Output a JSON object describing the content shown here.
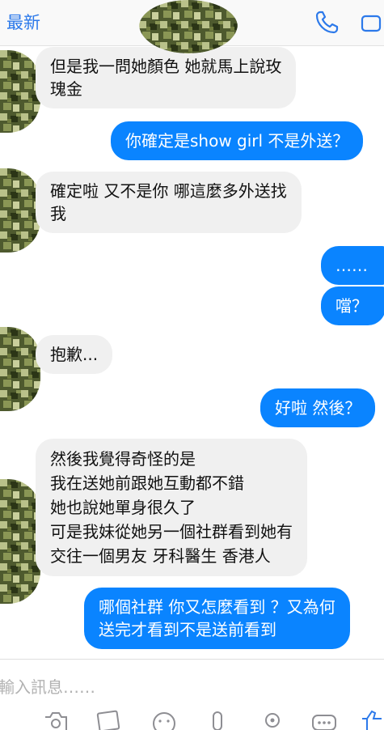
{
  "header": {
    "back_label": "最新",
    "call_icon": "phone-icon",
    "video_icon": "video-camera-icon",
    "accent_color": "#2c79ea"
  },
  "messages": [
    {
      "from": "them",
      "lines": [
        "但是我一問她顏色 她就馬上說玫",
        "瑰金"
      ]
    },
    {
      "from": "me",
      "lines": [
        "你確定是show girl 不是外送？"
      ]
    },
    {
      "from": "them",
      "lines": [
        "確定啦 又不是你 哪這麼多外送找",
        "我"
      ]
    },
    {
      "from": "me",
      "lines": [
        "……"
      ]
    },
    {
      "from": "me",
      "lines": [
        "噹？"
      ]
    },
    {
      "from": "them",
      "lines": [
        "抱歉..."
      ]
    },
    {
      "from": "me",
      "lines": [
        "好啦 然後？"
      ]
    },
    {
      "from": "them",
      "lines": [
        "然後我覺得奇怪的是",
        "我在送她前跟她互動都不錯",
        "她也說她單身很久了",
        "可是我妹從她另一個社群看到她有",
        "交往一個男友 牙科醫生 香港人"
      ]
    },
    {
      "from": "me",
      "lines": [
        "哪個社群  你又怎麼看到 ？又為何",
        "送完才看到不是送前看到"
      ]
    }
  ],
  "colors": {
    "outgoing_bubble": "#0a84ff",
    "incoming_bubble": "#f0f0f0"
  },
  "compose": {
    "placeholder": "輸入訊息……",
    "icons": [
      "camera-icon",
      "photo-icon",
      "emoji-icon",
      "microphone-icon",
      "location-icon",
      "more-icon",
      "like-icon"
    ]
  }
}
